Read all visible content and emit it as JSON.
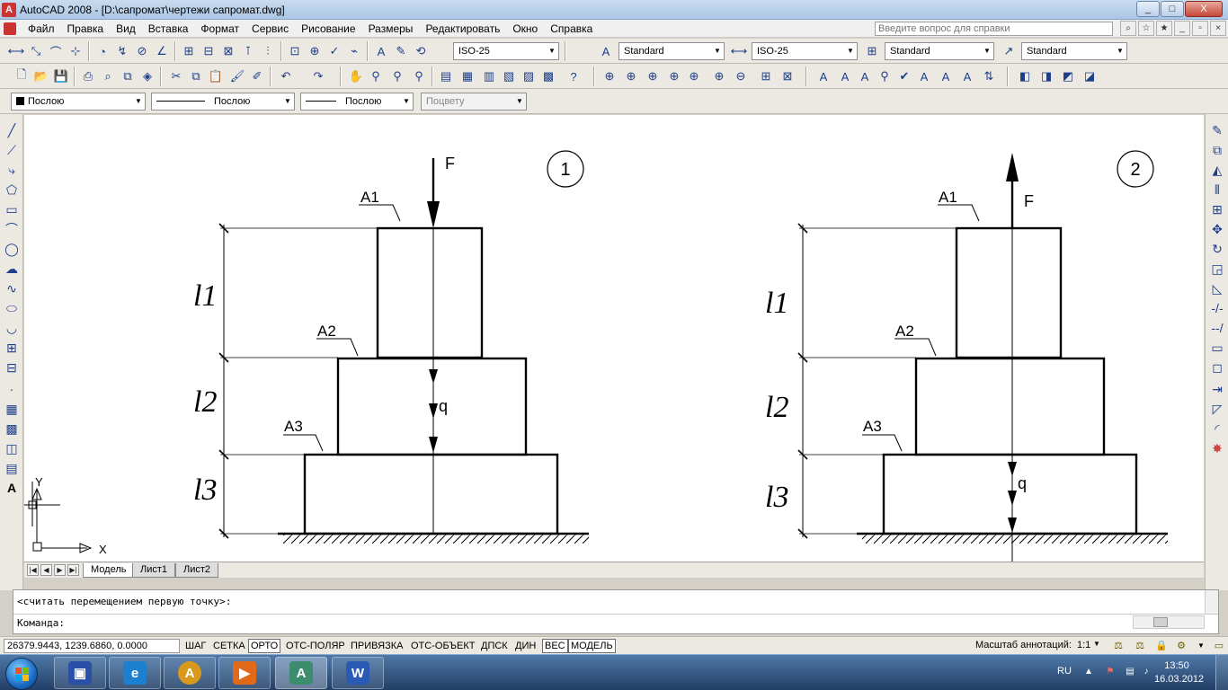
{
  "window": {
    "title": "AutoCAD 2008 - [D:\\сапромат\\чертежи сапромат.dwg]",
    "buttons": [
      "_",
      "□",
      "X"
    ]
  },
  "menu": {
    "items": [
      "Файл",
      "Правка",
      "Вид",
      "Вставка",
      "Формат",
      "Сервис",
      "Рисование",
      "Размеры",
      "Редактировать",
      "Окно",
      "Справка"
    ],
    "help_placeholder": "Введите вопрос для справки"
  },
  "toolbar": {
    "dim_style": "ISO-25",
    "text_style": "Standard",
    "dim_style2": "ISO-25",
    "table_style": "Standard",
    "multileader_style": "Standard"
  },
  "properties": {
    "color": "Послою",
    "linetype": "Послою",
    "lineweight": "Послою",
    "plotstyle": "Поцвету"
  },
  "drawing": {
    "fig1": {
      "number": "1",
      "force_label": "F",
      "q_label": "q",
      "areas": [
        "A1",
        "A2",
        "A3"
      ],
      "lengths": [
        "l1",
        "l2",
        "l3"
      ]
    },
    "fig2": {
      "number": "2",
      "force_label": "F",
      "q_label": "q",
      "areas": [
        "A1",
        "A2",
        "A3"
      ],
      "lengths": [
        "l1",
        "l2",
        "l3"
      ]
    },
    "ucs": {
      "x": "X",
      "y": "Y"
    }
  },
  "tabs": {
    "items": [
      "Модель",
      "Лист1",
      "Лист2"
    ],
    "active": "Модель"
  },
  "command": {
    "history": "<считать перемещением первую точку>:",
    "prompt": "Команда:"
  },
  "status": {
    "coords": "26379.9443, 1239.6860, 0.0000",
    "toggles": [
      "ШАГ",
      "СЕТКА",
      "ОРТО",
      "ОТС-ПОЛЯР",
      "ПРИВЯЗКА",
      "ОТС-ОБЪЕКТ",
      "ДПСК",
      "ДИН",
      "ВЕС",
      "МОДЕЛЬ"
    ],
    "annotation_scale_label": "Масштаб аннотаций:",
    "annotation_scale": "1:1"
  },
  "taskbar": {
    "lang": "RU",
    "time": "13:50",
    "date": "16.03.2012"
  }
}
